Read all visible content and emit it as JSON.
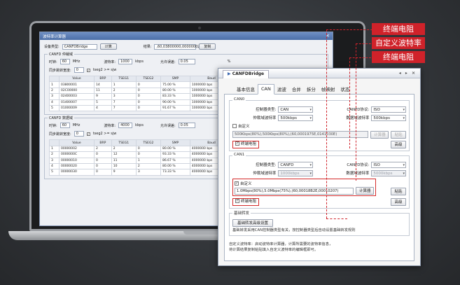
{
  "callouts": {
    "c1": "终端电阻",
    "c2": "自定义波特率",
    "c3": "终端电阻"
  },
  "calc": {
    "title": "波特率计算器",
    "device_type_label": "设备类型:",
    "device_type_value": "CANFDBridge",
    "calc_button": "计算",
    "result_label": "结果:",
    "result_value": ",60,03800000,00000002)",
    "copy_button": "复制",
    "arb_caption": "CANFD 仲裁域",
    "clock_label": "时钟:",
    "clock_value": "60",
    "mhz": "MHz",
    "baud_label": "波特率:",
    "baud_value_1": "1000",
    "kbps": "kbps",
    "tol_label": "允许误差:",
    "tol_value": "0.05",
    "percent": "%",
    "sjw_label": "同步跳转宽度:",
    "sjw_value": "0",
    "tseg_label": "tseg2 >= sjw",
    "data_caption": "CANFD 数据域",
    "baud_value_2": "4000",
    "table_headers": [
      "Value",
      "BRP",
      "TSEG1",
      "TSEG2",
      "SMP",
      "Baud",
      "Diff"
    ],
    "table1_rows": [
      [
        "1",
        "03800001",
        "14",
        "1",
        "0",
        "75.00 %",
        "1000000 bps",
        "0.00 %"
      ],
      [
        "2",
        "02C00000",
        "11",
        "2",
        "0",
        "80.00 %",
        "1000000 bps",
        "0.00 %"
      ],
      [
        "3",
        "02400003",
        "9",
        "3",
        "0",
        "83.33 %",
        "1000000 bps",
        "0.00 %"
      ],
      [
        "4",
        "01400007",
        "5",
        "7",
        "0",
        "90.00 %",
        "1000000 bps",
        "0.00 %"
      ],
      [
        "5",
        "01000009",
        "4",
        "7",
        "0",
        "91.67 %",
        "1000000 bps",
        "0.00 %"
      ]
    ],
    "table2_rows": [
      [
        "1",
        "00000002",
        "2",
        "2",
        "0",
        "80.00 %",
        "4000000 bps",
        "0.00 %"
      ],
      [
        "2",
        "0000000C",
        "0",
        "12",
        "0",
        "93.33 %",
        "4000000 bps",
        "0.00 %"
      ],
      [
        "3",
        "00000010",
        "0",
        "11",
        "1",
        "86.67 %",
        "4000000 bps",
        "0.00 %"
      ],
      [
        "4",
        "00000020",
        "0",
        "10",
        "2",
        "80.00 %",
        "4000000 bps",
        "0.00 %"
      ],
      [
        "5",
        "00000030",
        "0",
        "9",
        "3",
        "73.33 %",
        "4000000 bps",
        "0.00 %"
      ]
    ]
  },
  "bridge": {
    "title": "CANFDBridge",
    "tabs": [
      "基本信息",
      "CAN",
      "滤波",
      "合并",
      "拆分",
      "帧映射",
      "状态"
    ],
    "active_tab": "CAN",
    "can0": {
      "caption": "CAN0",
      "ctrl_type_label": "控制器类型:",
      "ctrl_type_value": "CAN",
      "proto_label": "CANFD协议:",
      "proto_value": "ISO",
      "arb_baud_label": "仲裁域波特率",
      "arb_baud_value": "500kbps",
      "data_baud_label": "数据域波特率",
      "data_baud_value": "500kbps",
      "custom_label": "自定义",
      "custom_value": "500Kbps(80%),500Kbps(80%),(60,0001975E,0141030E)",
      "calc_button": "计算器",
      "paste_button": "粘贴",
      "term_label": "终端电阻",
      "advanced_button": "高级"
    },
    "can1": {
      "caption": "CAN1",
      "ctrl_type_label": "控制器类型:",
      "ctrl_type_value": "CANFD",
      "proto_label": "CANFD协议:",
      "proto_value": "ISO",
      "arb_baud_label": "仲裁域波特率",
      "arb_baud_value": "1000kbps",
      "data_baud_label": "数据域波特率",
      "data_baud_value": "5000kbps",
      "custom_label": "自定义",
      "custom_value": "1.0Mbps(80%),5.0Mbps(75%),(60,00018B2E,00010207)",
      "calc_button": "计算器",
      "paste_button": "粘贴",
      "term_label": "终端电阻",
      "advanced_button": "高级"
    },
    "relay": {
      "caption": "基础转发",
      "button": "基础转发高级设置",
      "desc": "基础转发采用CAN控制器类型有关，按控制器类型后自动设置基础转发规则"
    },
    "note_line1": "自定义波特率：启动波特率计算器，计算所需要的波特率信息，",
    "note_line2": "将计算结果复制粘贴填入自定义波特率的编辑框即可。"
  }
}
